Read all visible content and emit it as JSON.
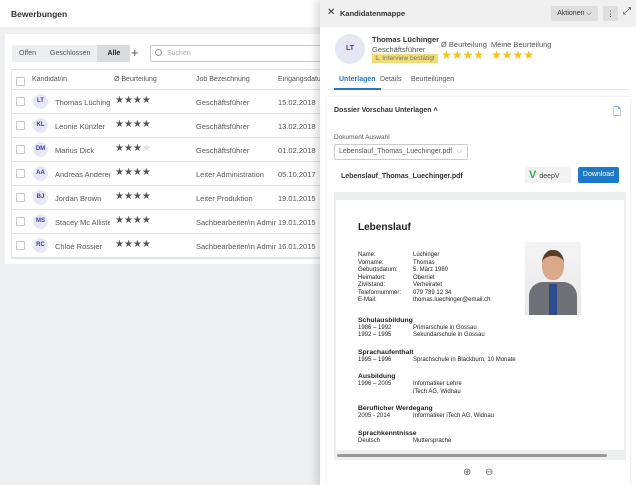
{
  "left": {
    "title": "Bewerbungen",
    "filters": [
      "Offen",
      "Geschlossen",
      "Alle"
    ],
    "active_filter": "Alle",
    "add_label": "+",
    "search_placeholder": "Suchen",
    "columns": [
      "Kandidat/in",
      "Ø Beurteilung",
      "Job Bezeichnung",
      "Eingangsdatum"
    ],
    "rows": [
      {
        "initials": "LT",
        "name": "Thomas Lüchinger",
        "rating": 4,
        "job": "Geschäftsführer",
        "date": "15.02.2018"
      },
      {
        "initials": "KL",
        "name": "Leonie Künzler",
        "rating": 4,
        "job": "Geschäftsführer",
        "date": "13.02.2018"
      },
      {
        "initials": "DM",
        "name": "Marius Dick",
        "rating": 3.5,
        "job": "Geschäftsführer",
        "date": "01.02.2018"
      },
      {
        "initials": "AA",
        "name": "Andreas Anderegg",
        "rating": 4,
        "job": "Leiter Administration",
        "date": "05.10.2017"
      },
      {
        "initials": "BJ",
        "name": "Jordan Brown",
        "rating": 4,
        "job": "Leiter Produktion",
        "date": "19.01.2015"
      },
      {
        "initials": "MS",
        "name": "Stacey Mc Allister",
        "rating": 4,
        "job": "Sachbearbeiter/in Administration",
        "date": "19.01.2015"
      },
      {
        "initials": "RC",
        "name": "Chloé Rossier",
        "rating": 4,
        "job": "Sachbearbeiter/in Administration",
        "date": "16.01.2015"
      }
    ]
  },
  "panel": {
    "title": "Kandidatenmappe",
    "actions": "Aktionen",
    "candidate": {
      "initials": "LT",
      "name": "Thomas Lüchinger",
      "job": "Geschäftsführer",
      "status": "1. Interview bestätigt",
      "avg_label": "Ø Beurteilung",
      "avg_rating": 4,
      "my_label": "Meine Beurteilung",
      "my_rating": 4
    },
    "tabs": [
      "Unterlagen",
      "Details",
      "Beurteilungen"
    ],
    "active_tab": "Unterlagen",
    "section_title": "Dossier Vorschau Unterlagen",
    "select_label": "Dokument Auswahl",
    "select_value": "Lebenslauf_Thomas_Luechinger.pdf",
    "file_name": "Lebenslauf_Thomas_Luechinger.pdf",
    "deepv": "deepV",
    "download": "Download"
  },
  "cv": {
    "title": "Lebenslauf",
    "personal": [
      [
        "Name:",
        "Lüchinger"
      ],
      [
        "Vorname:",
        "Thomas"
      ],
      [
        "Geburtsdatum:",
        "5. März 1980"
      ],
      [
        "Heimatort:",
        "Oberriet"
      ],
      [
        "Zivilstand:",
        "Verheiratet"
      ],
      [
        "Telefonnummer:",
        "079 789 12 34"
      ],
      [
        "E-Mail:",
        "thomas.luechinger@email.ch"
      ]
    ],
    "sections": [
      {
        "title": "Schulausbildung",
        "entries": [
          [
            "1986 – 1992",
            "Primarschule in Gossau"
          ],
          [
            "1992 – 1995",
            "Sekundarschule in Gossau"
          ]
        ]
      },
      {
        "title": "Sprachaufenthalt",
        "entries": [
          [
            "1995 – 1996",
            "Sprachschule in Blackburn, 10 Monate"
          ]
        ]
      },
      {
        "title": "Ausbildung",
        "entries": [
          [
            "1996 – 2005",
            "Informatiker Lehre"
          ],
          [
            "",
            "iTech AG, Widnau"
          ]
        ]
      },
      {
        "title": "Beruflicher Werdegang",
        "entries": [
          [
            "2005 - 2014",
            "Informatiker iTech AG, Widnau"
          ]
        ]
      },
      {
        "title": "Sprachkenntnisse",
        "entries": [
          [
            "Deutsch",
            "Muttersprache"
          ]
        ]
      }
    ]
  },
  "colors": {
    "accent": "#2277c9",
    "star": "#f4c316",
    "badge": "#f2dc7a"
  }
}
